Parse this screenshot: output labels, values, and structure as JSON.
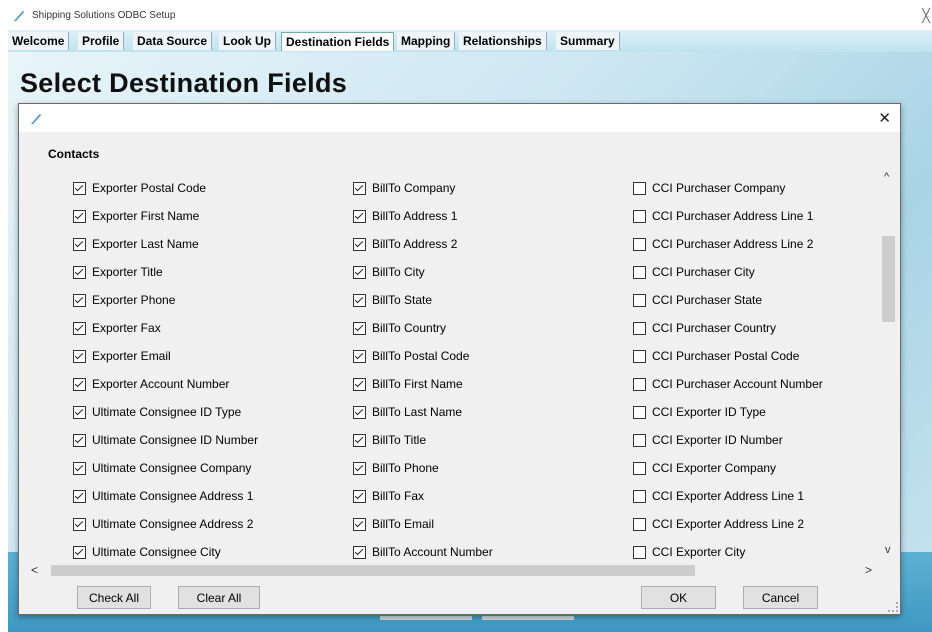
{
  "window": {
    "title": "Shipping Solutions ODBC Setup",
    "close_glyph": "╳"
  },
  "tabs": [
    {
      "label": "Welcome",
      "active": false
    },
    {
      "label": "Profile",
      "active": false
    },
    {
      "label": "Data Source",
      "active": false
    },
    {
      "label": "Look Up",
      "active": false
    },
    {
      "label": "Destination Fields",
      "active": true
    },
    {
      "label": "Mapping",
      "active": false
    },
    {
      "label": "Relationships",
      "active": false
    },
    {
      "label": "Summary",
      "active": false
    }
  ],
  "page": {
    "heading": "Select Destination Fields"
  },
  "dialog": {
    "close_glyph": "✕",
    "group_label": "Contacts",
    "columns": [
      [
        {
          "label": "Exporter Postal Code",
          "checked": true
        },
        {
          "label": "Exporter First Name",
          "checked": true
        },
        {
          "label": "Exporter Last Name",
          "checked": true
        },
        {
          "label": "Exporter Title",
          "checked": true
        },
        {
          "label": "Exporter Phone",
          "checked": true
        },
        {
          "label": "Exporter Fax",
          "checked": true
        },
        {
          "label": "Exporter Email",
          "checked": true
        },
        {
          "label": "Exporter Account Number",
          "checked": true
        },
        {
          "label": "Ultimate Consignee ID Type",
          "checked": true
        },
        {
          "label": "Ultimate Consignee  ID Number",
          "checked": true
        },
        {
          "label": "Ultimate Consignee  Company",
          "checked": true
        },
        {
          "label": "Ultimate Consignee  Address 1",
          "checked": true
        },
        {
          "label": "Ultimate Consignee  Address 2",
          "checked": true
        },
        {
          "label": "Ultimate Consignee  City",
          "checked": true
        }
      ],
      [
        {
          "label": "BillTo Company",
          "checked": true
        },
        {
          "label": "BillTo Address 1",
          "checked": true
        },
        {
          "label": "BillTo Address 2",
          "checked": true
        },
        {
          "label": "BillTo City",
          "checked": true
        },
        {
          "label": "BillTo State",
          "checked": true
        },
        {
          "label": "BillTo Country",
          "checked": true
        },
        {
          "label": "BillTo Postal Code",
          "checked": true
        },
        {
          "label": "BillTo First Name",
          "checked": true
        },
        {
          "label": "BillTo Last Name",
          "checked": true
        },
        {
          "label": "BillTo Title",
          "checked": true
        },
        {
          "label": "BillTo  Phone",
          "checked": true
        },
        {
          "label": "BillTo Fax",
          "checked": true
        },
        {
          "label": "BillTo Email",
          "checked": true
        },
        {
          "label": "BillTo Account Number",
          "checked": true
        }
      ],
      [
        {
          "label": "CCI Purchaser Company",
          "checked": false
        },
        {
          "label": "CCI Purchaser Address Line 1",
          "checked": false
        },
        {
          "label": "CCI Purchaser Address Line 2",
          "checked": false
        },
        {
          "label": "CCI Purchaser City",
          "checked": false
        },
        {
          "label": "CCI Purchaser State",
          "checked": false
        },
        {
          "label": "CCI Purchaser Country",
          "checked": false
        },
        {
          "label": "CCI Purchaser Postal Code",
          "checked": false
        },
        {
          "label": "CCI Purchaser Account Number",
          "checked": false
        },
        {
          "label": "CCI Exporter ID Type",
          "checked": false
        },
        {
          "label": "CCI Exporter ID Number",
          "checked": false
        },
        {
          "label": "CCI Exporter Company",
          "checked": false
        },
        {
          "label": "CCI Exporter Address Line 1",
          "checked": false
        },
        {
          "label": "CCI Exporter Address Line 2",
          "checked": false
        },
        {
          "label": "CCI Exporter City",
          "checked": false
        }
      ]
    ],
    "buttons": {
      "check_all": "Check All",
      "clear_all": "Clear All",
      "ok": "OK",
      "cancel": "Cancel"
    },
    "scroll_glyphs": {
      "up": "^",
      "down": "v",
      "left": "<",
      "right": ">"
    }
  },
  "colors": {
    "accent_band": "#3e98c2",
    "dialog_bg": "#f0f0f0"
  }
}
